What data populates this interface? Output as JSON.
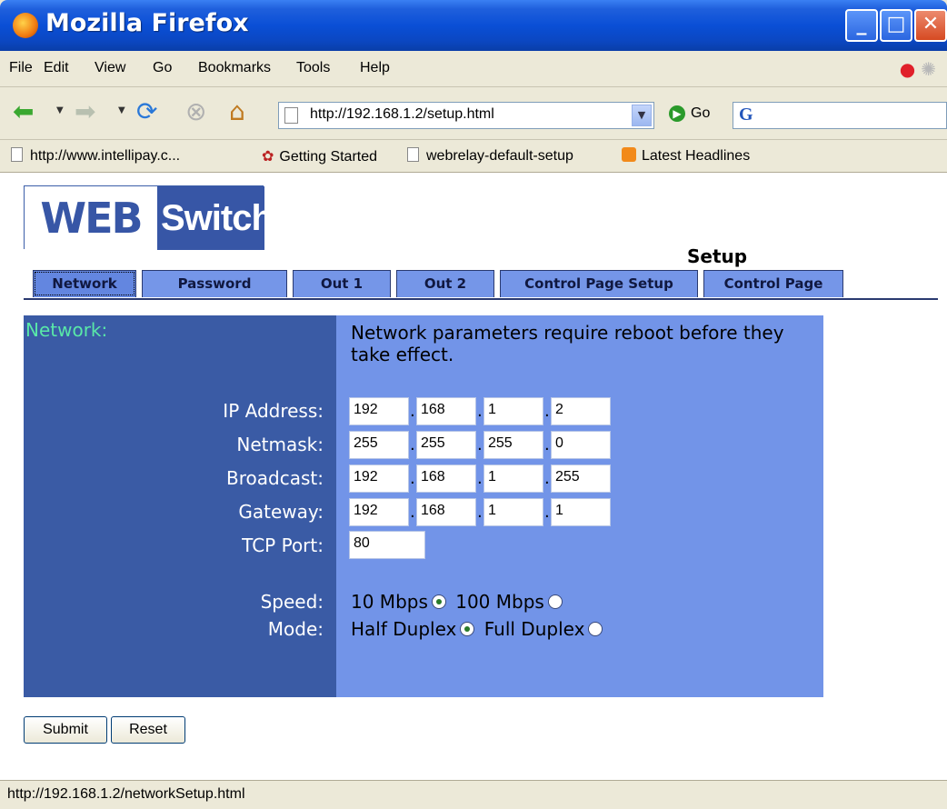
{
  "window": {
    "title": "Mozilla Firefox"
  },
  "menu": [
    "File",
    "Edit",
    "View",
    "Go",
    "Bookmarks",
    "Tools",
    "Help"
  ],
  "toolbar": {
    "url": "http://192.168.1.2/setup.html",
    "go_label": "Go",
    "search_logo": "G"
  },
  "bookmarks": [
    {
      "label": "http://www.intellipay.c...",
      "icon": "page-icon"
    },
    {
      "label": "Getting Started",
      "icon": "firefox-icon"
    },
    {
      "label": "webrelay-default-setup",
      "icon": "page-icon"
    },
    {
      "label": "Latest Headlines",
      "icon": "rss-icon"
    }
  ],
  "page": {
    "logo": {
      "left": "WEB",
      "right": "Switch"
    },
    "heading": "Setup",
    "tabs": [
      "Network",
      "Password",
      "Out 1",
      "Out 2",
      "Control Page Setup",
      "Control Page"
    ],
    "active_tab": "Network",
    "section_label": "Network:",
    "note": "Network parameters require reboot before they take effect.",
    "fields": {
      "ip_label": "IP Address:",
      "ip": [
        "192",
        "168",
        "1",
        "2"
      ],
      "netmask_label": "Netmask:",
      "netmask": [
        "255",
        "255",
        "255",
        "0"
      ],
      "broadcast_label": "Broadcast:",
      "broadcast": [
        "192",
        "168",
        "1",
        "255"
      ],
      "gateway_label": "Gateway:",
      "gateway": [
        "192",
        "168",
        "1",
        "1"
      ],
      "tcp_label": "TCP Port:",
      "tcp_port": "80"
    },
    "speed": {
      "label": "Speed:",
      "opt1": "10 Mbps",
      "opt2": "100 Mbps",
      "selected": "10 Mbps"
    },
    "mode": {
      "label": "Mode:",
      "opt1": "Half Duplex",
      "opt2": "Full Duplex",
      "selected": "Half Duplex"
    },
    "buttons": {
      "submit": "Submit",
      "reset": "Reset"
    }
  },
  "status": "http://192.168.1.2/networkSetup.html",
  "colors": {
    "tab": "#7596e8",
    "panel_left": "#3a5ba5",
    "panel_right": "#7294e8",
    "section_label": "#59e8a8"
  }
}
